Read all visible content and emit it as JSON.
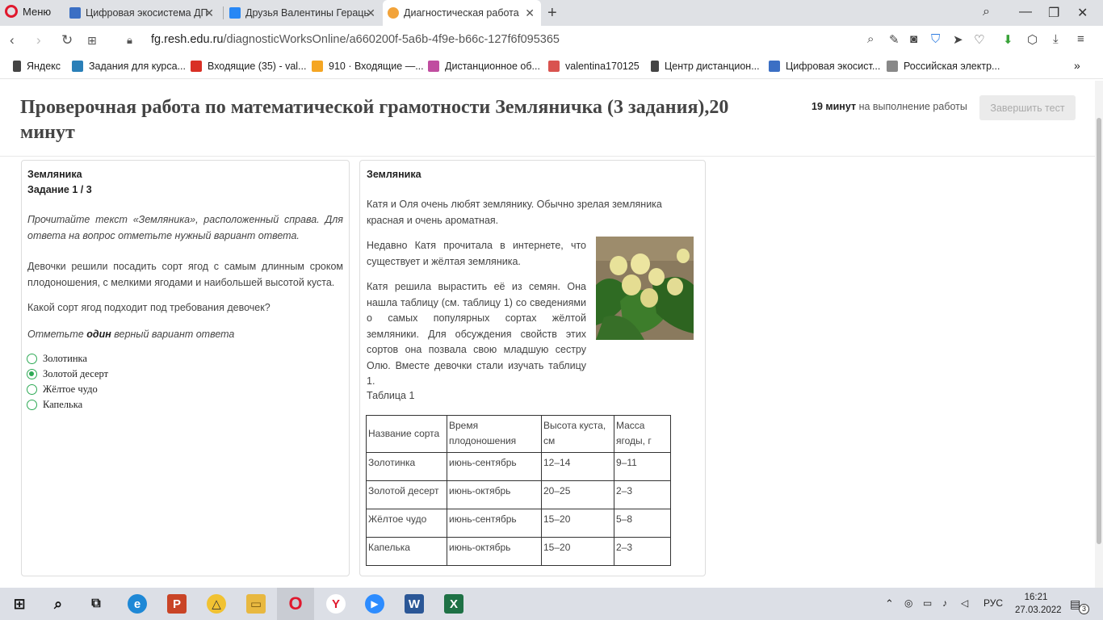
{
  "browser": {
    "menu_label": "Меню",
    "tabs": [
      {
        "title": "Цифровая экосистема ДП",
        "color": "#3b6fc4"
      },
      {
        "title": "Друзья Валентины Гераць",
        "color": "#2787f5"
      },
      {
        "title": "Диагностическая работа",
        "color": "#f2a33a"
      }
    ],
    "url_host": "fg.resh.edu.ru",
    "url_path": "/diagnosticWorksOnline/a660200f-5a6b-4f9e-b66c-127f6f095365",
    "bookmarks": [
      {
        "label": "Яндекс",
        "color": "#444"
      },
      {
        "label": "Задания для курса...",
        "color": "#2a7fb8"
      },
      {
        "label": "Входящие (35) - val...",
        "color": "#d93025"
      },
      {
        "label": "910 · Входящие —...",
        "color": "#f5a623"
      },
      {
        "label": "Дистанционное об...",
        "color": "#c04da0"
      },
      {
        "label": "valentina170125",
        "color": "#d9534f"
      },
      {
        "label": "Центр дистанцион...",
        "color": "#444"
      },
      {
        "label": "Цифровая экосист...",
        "color": "#3b6fc4"
      },
      {
        "label": "Российская электр...",
        "color": "#888"
      }
    ]
  },
  "header": {
    "title": "Проверочная работа по математической грамотности Земляничка (3 задания),20 минут",
    "timer_value": "19 минут",
    "timer_suffix": " на выполнение работы",
    "finish_button": "Завершить тест"
  },
  "task": {
    "section": "Земляника",
    "counter": "Задание 1 / 3",
    "instruction": "Прочитайте текст «Земляника», расположенный справа. Для ответа на вопрос отметьте нужный вариант ответа.",
    "body": "Девочки решили посадить сорт ягод с самым длинным сроком плодоношения, с мелкими ягодами и наибольшей высотой куста.",
    "question": "Какой сорт ягод подходит под требования девочек?",
    "hint_before": "Отметьте ",
    "hint_bold": "один",
    "hint_after": " верный вариант ответа",
    "options": [
      {
        "label": "Золотинка",
        "checked": false
      },
      {
        "label": "Золотой десерт",
        "checked": true
      },
      {
        "label": "Жёлтое чудо",
        "checked": false
      },
      {
        "label": "Капелька",
        "checked": false
      }
    ]
  },
  "text": {
    "title": "Земляника",
    "p1": "Катя и Оля очень любят землянику. Обычно зрелая земляника красная и очень ароматная.",
    "p2": "Недавно Катя прочитала в интернете, что существует и жёлтая земляника.",
    "p3": "Катя решила вырастить её из семян. Она нашла таблицу (см. таблицу 1) со сведениями о самых популярных сортах жёлтой земляники. Для обсуждения свойств этих сортов она позвала свою младшую сестру Олю. Вместе девочки стали изучать таблицу 1.",
    "table_caption": "Таблица 1",
    "table": {
      "headers": [
        "Название сорта",
        "Время плодоношения",
        "Высота куста, см",
        "Масса ягоды, г"
      ],
      "rows": [
        [
          "Золотинка",
          "июнь-сентябрь",
          "12–14",
          "9–11"
        ],
        [
          "Золотой десерт",
          "июнь-октябрь",
          "20–25",
          "2–3"
        ],
        [
          "Жёлтое чудо",
          "июнь-сентябрь",
          "15–20",
          "5–8"
        ],
        [
          "Капелька",
          "июнь-октябрь",
          "15–20",
          "2–3"
        ]
      ]
    }
  },
  "taskbar": {
    "lang": "РУС",
    "time": "16:21",
    "date": "27.03.2022",
    "notifications": "3"
  }
}
